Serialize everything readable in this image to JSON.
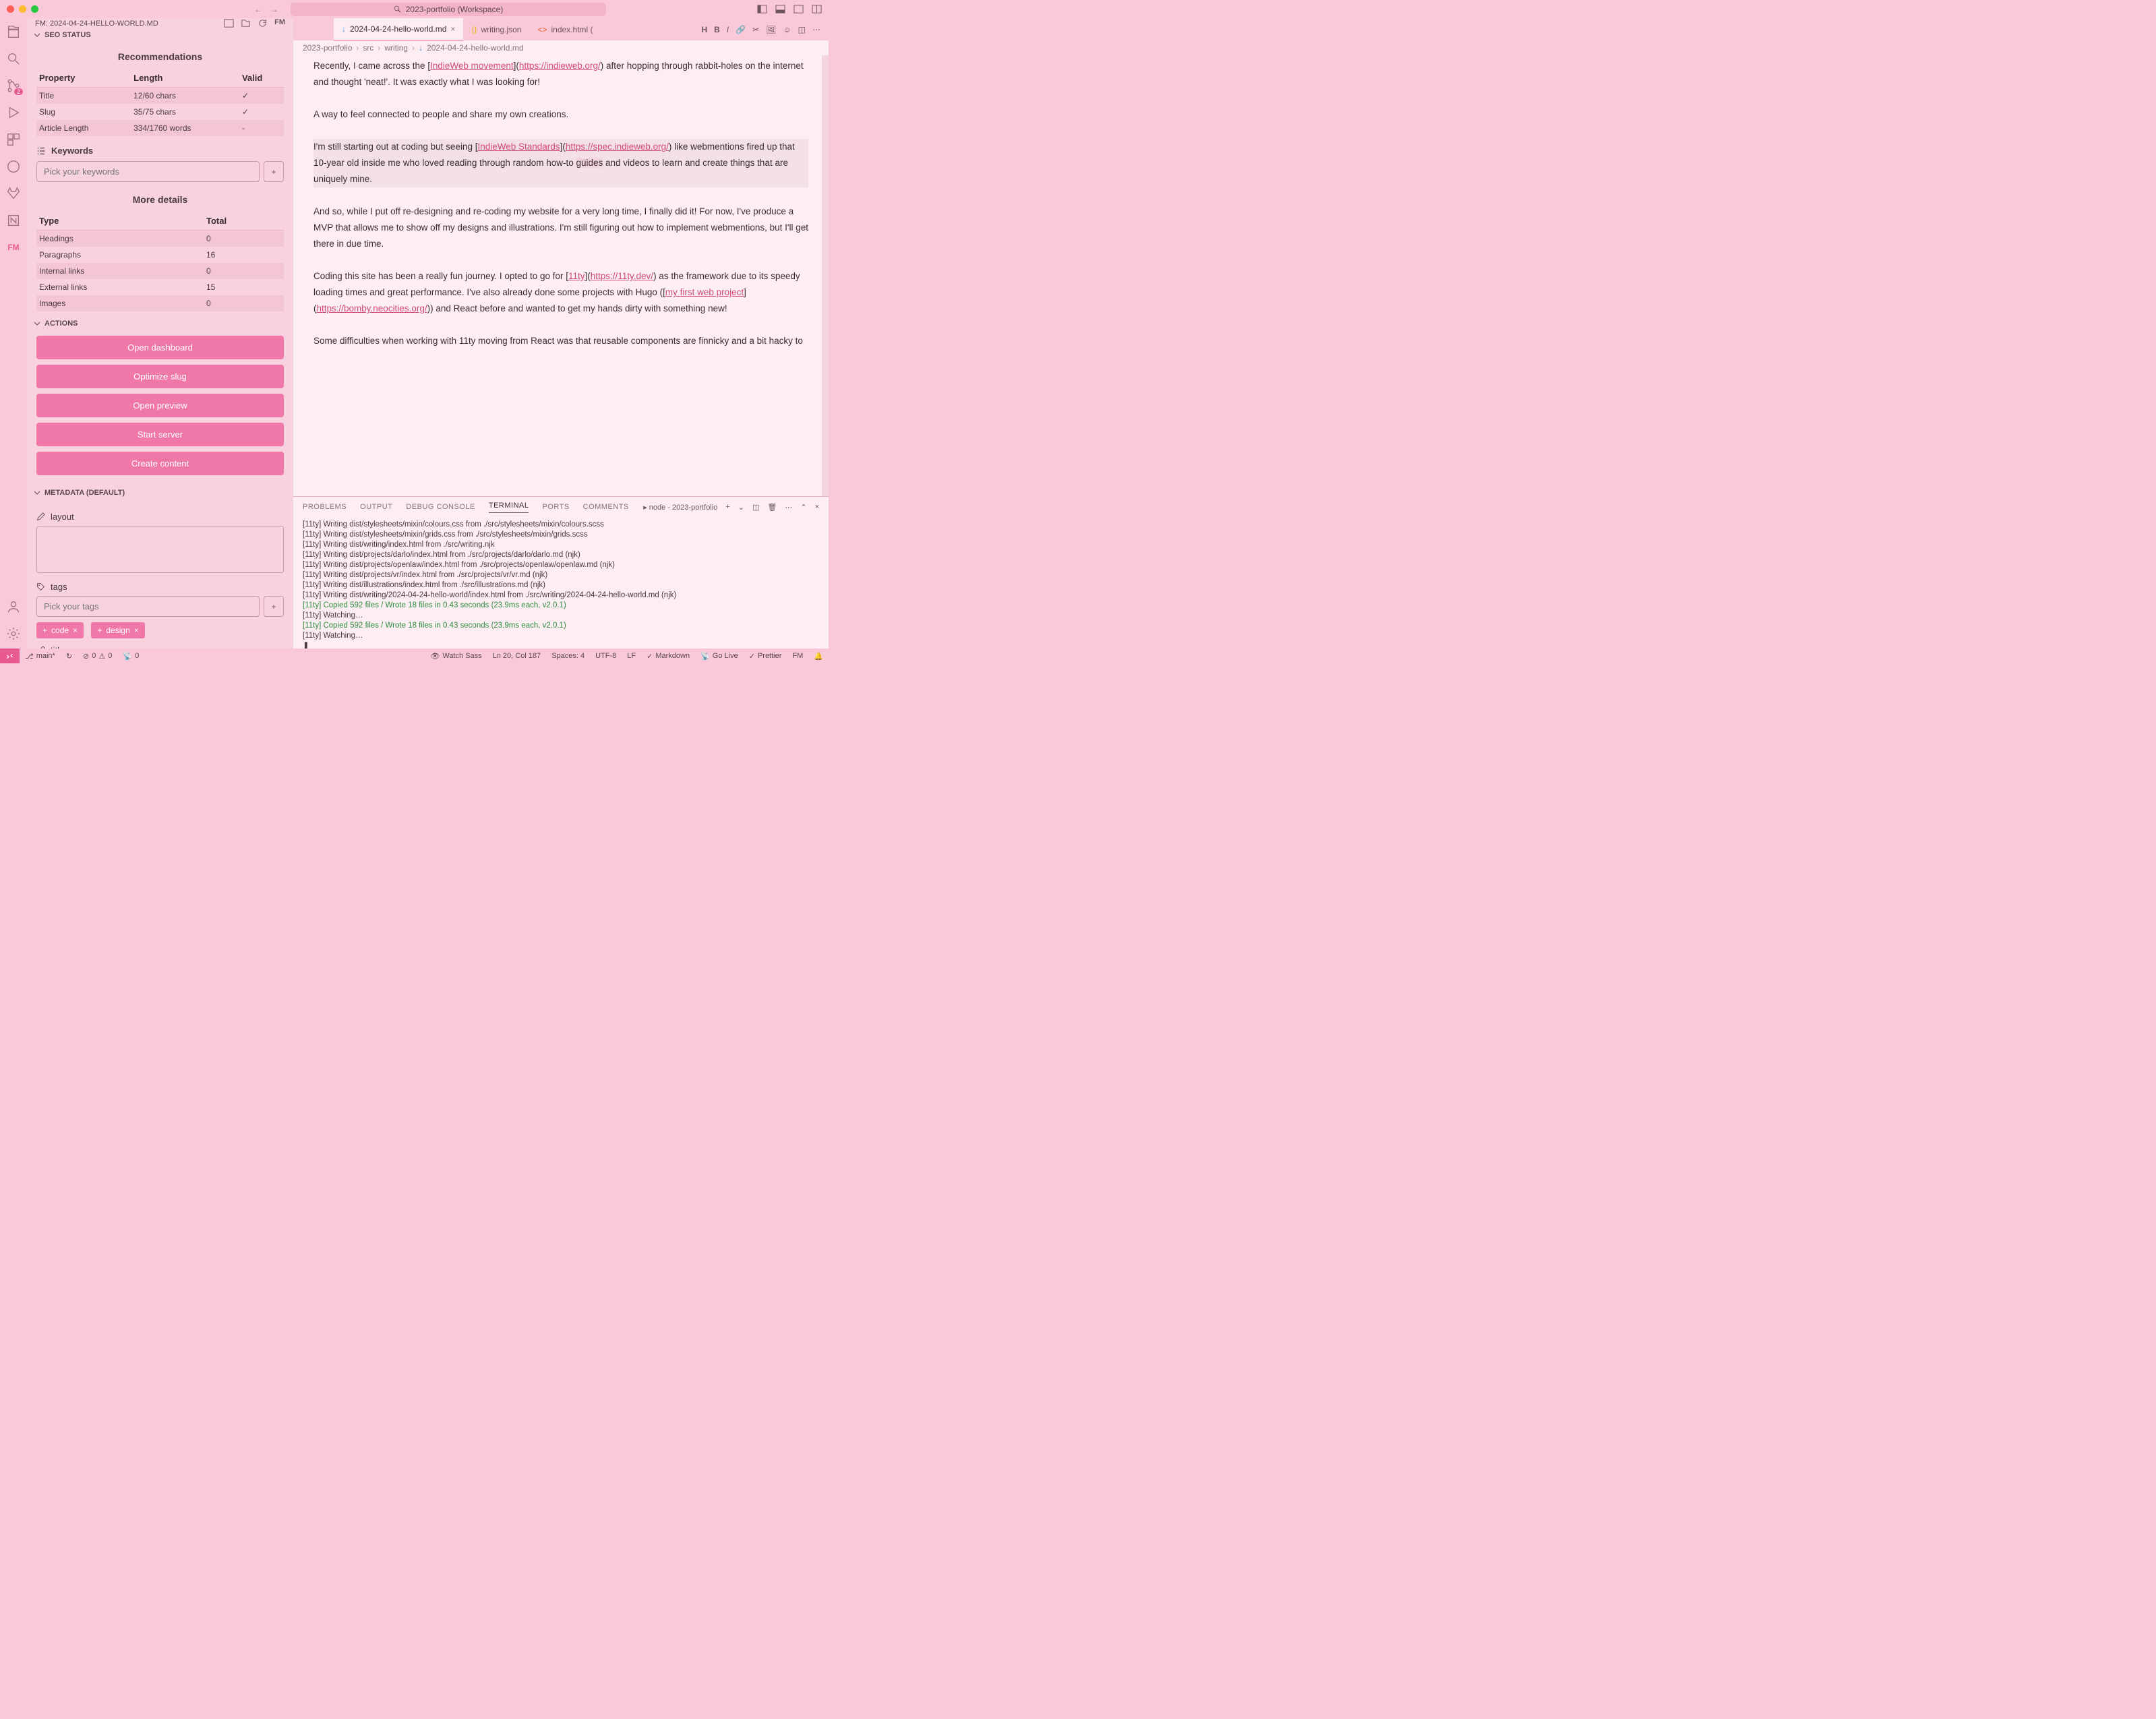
{
  "window": {
    "title": "2023-portfolio (Workspace)"
  },
  "sidebar_header": {
    "filename": "FM: 2024-04-24-HELLO-WORLD.MD"
  },
  "activitybar": {
    "scm_badge": "2",
    "fm_label": "FM"
  },
  "seo": {
    "section_label": "SEO STATUS",
    "recommendations_label": "Recommendations",
    "headers": {
      "property": "Property",
      "length": "Length",
      "valid": "Valid"
    },
    "rows": [
      {
        "property": "Title",
        "length": "12/60 chars",
        "valid": "✓"
      },
      {
        "property": "Slug",
        "length": "35/75 chars",
        "valid": "✓"
      },
      {
        "property": "Article Length",
        "length": "334/1760 words",
        "valid": "-"
      }
    ],
    "keywords_label": "Keywords",
    "keywords_placeholder": "Pick your keywords",
    "more_details_label": "More details",
    "details_headers": {
      "type": "Type",
      "total": "Total"
    },
    "details": [
      {
        "type": "Headings",
        "total": "0"
      },
      {
        "type": "Paragraphs",
        "total": "16"
      },
      {
        "type": "Internal links",
        "total": "0"
      },
      {
        "type": "External links",
        "total": "15"
      },
      {
        "type": "Images",
        "total": "0"
      }
    ]
  },
  "actions": {
    "section_label": "ACTIONS",
    "buttons": {
      "open_dashboard": "Open dashboard",
      "optimize_slug": "Optimize slug",
      "open_preview": "Open preview",
      "start_server": "Start server",
      "create_content": "Create content"
    }
  },
  "metadata": {
    "section_label": "METADATA (DEFAULT)",
    "layout_label": "layout",
    "tags_label": "tags",
    "tags_placeholder": "Pick your tags",
    "tags": [
      "code",
      "design"
    ],
    "title_label": "title"
  },
  "tabs": [
    {
      "label": "2024-04-24-hello-world.md",
      "active": true,
      "icon": "md"
    },
    {
      "label": "writing.json",
      "active": false,
      "icon": "json"
    },
    {
      "label": "index.html (",
      "active": false,
      "icon": "html"
    }
  ],
  "breadcrumb": [
    "2023-portfolio",
    "src",
    "writing",
    "2024-04-24-hello-world.md"
  ],
  "editor": {
    "p1_a": "Recently, I came across the [",
    "p1_link1": "IndieWeb movement",
    "p1_b": "](",
    "p1_url1": "https://indieweb.org/",
    "p1_c": ") after hopping through rabbit-holes on the internet and thought 'neat!'. It was exactly what I was looking for!",
    "p2": "A way to feel connected to people and share my own creations.",
    "p3_a": "I'm still starting out at coding but seeing [",
    "p3_link1": "IndieWeb Standards",
    "p3_b": "](",
    "p3_url1": "https://spec.indieweb.org/",
    "p3_c": ") like webmentions fired up that 10-year old inside me who loved reading through random how-to ",
    "p3_hl": "guides",
    "p3_d": " and videos to learn and create things that are uniquely mine.",
    "p4": "And so, while I put off re-designing and re-coding my website for a very long time, I finally did it! For now, I've produce a MVP that allows me to show off my designs and illustrations. I'm still figuring out how to implement webmentions, but I'll get there in due time.",
    "p5_a": "Coding this site has been a really fun journey. I opted to go for [",
    "p5_link1": "11ty",
    "p5_b": "](",
    "p5_url1": "https://11ty.dev/",
    "p5_c": ") as the framework due to its speedy loading times and great performance. I've also already done some projects with Hugo ([",
    "p5_link2": "my first web project",
    "p5_d": "](",
    "p5_url2": "https://bomby.neocities.org/",
    "p5_e": ")) and React before and wanted to get my hands dirty with something new!",
    "p6": "Some difficulties when working with 11ty moving from React was that reusable components are finnicky and a bit hacky to"
  },
  "terminal": {
    "tabs": [
      "PROBLEMS",
      "OUTPUT",
      "DEBUG CONSOLE",
      "TERMINAL",
      "PORTS",
      "COMMENTS"
    ],
    "active_tab": "TERMINAL",
    "session": "node - 2023-portfolio",
    "lines": [
      "[11ty] Writing dist/stylesheets/mixin/colours.css from ./src/stylesheets/mixin/colours.scss",
      "[11ty] Writing dist/stylesheets/mixin/grids.css from ./src/stylesheets/mixin/grids.scss",
      "[11ty] Writing dist/writing/index.html from ./src/writing.njk",
      "[11ty] Writing dist/projects/darlo/index.html from ./src/projects/darlo/darlo.md (njk)",
      "[11ty] Writing dist/projects/openlaw/index.html from ./src/projects/openlaw/openlaw.md (njk)",
      "[11ty] Writing dist/projects/vr/index.html from ./src/projects/vr/vr.md (njk)",
      "[11ty] Writing dist/illustrations/index.html from ./src/illustrations.md (njk)",
      "[11ty] Writing dist/writing/2024-04-24-hello-world/index.html from ./src/writing/2024-04-24-hello-world.md (njk)"
    ],
    "green_lines": [
      "[11ty] Copied 592 files / Wrote 18 files in 0.43 seconds (23.9ms each, v2.0.1)",
      "[11ty] Copied 592 files / Wrote 18 files in 0.43 seconds (23.9ms each, v2.0.1)"
    ],
    "watching": "[11ty] Watching…",
    "prompt": "❚"
  },
  "statusbar": {
    "branch": "main*",
    "sync": "↻",
    "errors": "0",
    "warnings": "0",
    "ports": "0",
    "watch_sass": "Watch Sass",
    "cursor": "Ln 20, Col 187",
    "spaces": "Spaces: 4",
    "encoding": "UTF-8",
    "eol": "LF",
    "lang": "Markdown",
    "golive": "Go Live",
    "prettier": "Prettier",
    "fm": "FM"
  }
}
